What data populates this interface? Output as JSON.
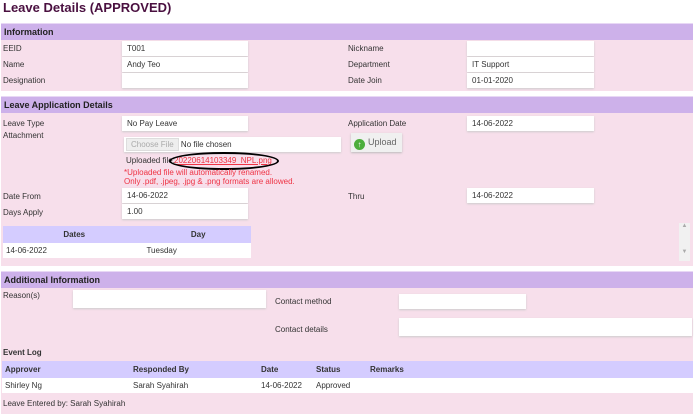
{
  "page_title": "Leave Details (APPROVED)",
  "information": {
    "header": "Information",
    "eeid_label": "EEID",
    "eeid": "T001",
    "name_label": "Name",
    "name": "Andy Teo",
    "designation_label": "Designation",
    "designation": "",
    "nickname_label": "Nickname",
    "nickname": "",
    "department_label": "Department",
    "department": "IT Support",
    "date_join_label": "Date Join",
    "date_join": "01-01-2020"
  },
  "application": {
    "header": "Leave Application Details",
    "leave_type_label": "Leave Type",
    "leave_type": "No Pay Leave",
    "application_date_label": "Application Date",
    "application_date": "14-06-2022",
    "attachment_label": "Attachment",
    "choose_file": "Choose File",
    "no_file": "No file chosen",
    "upload_label": "Upload",
    "uploaded_file_label": "Uploaded file:",
    "uploaded_file": "20220614103349_NPL.png",
    "note1": "*Uploaded file will automatically renamed.",
    "note2": "Only .pdf, .jpeg, .jpg & .png formats are allowed.",
    "date_from_label": "Date From",
    "date_from": "14-06-2022",
    "thru_label": "Thru",
    "thru": "14-06-2022",
    "days_apply_label": "Days Apply",
    "days_apply": "1.00",
    "dates_table": {
      "headers": [
        "Dates",
        "Day"
      ],
      "rows": [
        [
          "14-06-2022",
          "Tuesday"
        ]
      ]
    }
  },
  "additional": {
    "header": "Additional Information",
    "reasons_label": "Reason(s)",
    "reasons": "",
    "contact_method_label": "Contact method",
    "contact_method": "",
    "contact_details_label": "Contact details",
    "contact_details": "",
    "event_log_label": "Event Log",
    "event_log": {
      "headers": [
        "Approver",
        "Responded By",
        "Date",
        "Status",
        "Remarks"
      ],
      "rows": [
        [
          "Shirley Ng",
          "Sarah Syahirah",
          "14-06-2022",
          "Approved",
          ""
        ]
      ]
    },
    "entered_by": "Leave Entered by: Sarah Syahirah"
  }
}
